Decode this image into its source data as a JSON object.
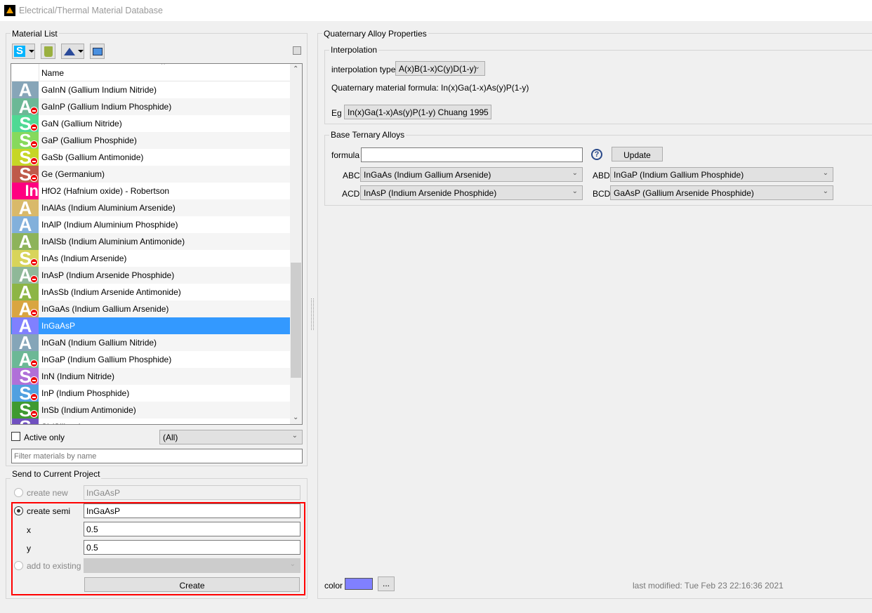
{
  "window": {
    "title": "Electrical/Thermal Material Database"
  },
  "material_list": {
    "title": "Material List",
    "column_name": "Name",
    "items": [
      {
        "name": "GaInN (Gallium Indium Nitride)",
        "letter": "A",
        "color": "#87a5b8",
        "badge": false
      },
      {
        "name": "GaInP (Gallium Indium Phosphide)",
        "letter": "A",
        "color": "#6cb896",
        "badge": true
      },
      {
        "name": "GaN (Gallium Nitride)",
        "letter": "S",
        "color": "#4fd994",
        "badge": true
      },
      {
        "name": "GaP (Gallium Phosphide)",
        "letter": "S",
        "color": "#86d95c",
        "badge": true
      },
      {
        "name": "GaSb (Gallium Antimonide)",
        "letter": "S",
        "color": "#c6d626",
        "badge": true
      },
      {
        "name": "Ge (Germanium)",
        "letter": "S",
        "color": "#bf5a4a",
        "badge": true
      },
      {
        "name": "HfO2 (Hafnium oxide) - Robertson",
        "letter": "In",
        "color": "#ff0080",
        "badge": false
      },
      {
        "name": "InAlAs (Indium Aluminium Arsenide)",
        "letter": "A",
        "color": "#d9b96a",
        "badge": false
      },
      {
        "name": "InAlP (Indium Aluminium Phosphide)",
        "letter": "A",
        "color": "#82b0db",
        "badge": false
      },
      {
        "name": "InAlSb (Indium Aluminium Antimonide)",
        "letter": "A",
        "color": "#8db35a",
        "badge": false
      },
      {
        "name": "InAs (Indium Arsenide)",
        "letter": "S",
        "color": "#d8d45a",
        "badge": true
      },
      {
        "name": "InAsP (Indium Arsenide Phosphide)",
        "letter": "A",
        "color": "#8fb898",
        "badge": true
      },
      {
        "name": "InAsSb (Indium Arsenide Antimonide)",
        "letter": "A",
        "color": "#8db545",
        "badge": false
      },
      {
        "name": "InGaAs (Indium Gallium Arsenide)",
        "letter": "A",
        "color": "#d9a540",
        "badge": true
      },
      {
        "name": "InGaAsP",
        "letter": "A",
        "color": "#8080ff",
        "badge": false,
        "selected": true
      },
      {
        "name": "InGaN (Indium Gallium Nitride)",
        "letter": "A",
        "color": "#85a5b8",
        "badge": false
      },
      {
        "name": "InGaP (Indium Gallium Phosphide)",
        "letter": "A",
        "color": "#6cb896",
        "badge": true
      },
      {
        "name": "InN (Indium Nitride)",
        "letter": "S",
        "color": "#b070d8",
        "badge": true
      },
      {
        "name": "InP (Indium Phosphide)",
        "letter": "S",
        "color": "#50a0e0",
        "badge": true
      },
      {
        "name": "InSb (Indium Antimonide)",
        "letter": "S",
        "color": "#3f9a30",
        "badge": true
      },
      {
        "name": "Si (Silicon)",
        "letter": "S",
        "color": "#7050c0",
        "badge": false
      }
    ],
    "active_only_label": "Active only",
    "category_value": "(All)",
    "filter_placeholder": "Filter materials by name"
  },
  "send": {
    "title": "Send to Current Project",
    "create_new_label": "create new",
    "create_new_value": "InGaAsP",
    "create_semi_label": "create semi",
    "create_semi_value": "InGaAsP",
    "x_label": "x",
    "x_value": "0.5",
    "y_label": "y",
    "y_value": "0.5",
    "add_existing_label": "add to existing",
    "create_button": "Create"
  },
  "props": {
    "title": "Quaternary Alloy Properties",
    "interp_title": "Interpolation",
    "interp_type_label": "interpolation type",
    "interp_type_value": "A(x)B(1-x)C(y)D(1-y)",
    "formula_text": "Quaternary material formula: In(x)Ga(1-x)As(y)P(1-y)",
    "eg_label": "Eg",
    "eg_value": "In(x)Ga(1-x)As(y)P(1-y) Chuang 1995",
    "ternary_title": "Base Ternary Alloys",
    "formula_label": "formula",
    "formula_value": "",
    "update_button": "Update",
    "abc_label": "ABC",
    "abc_value": "InGaAs (Indium Gallium Arsenide)",
    "abd_label": "ABD",
    "abd_value": "InGaP (Indium Gallium Phosphide)",
    "acd_label": "ACD",
    "acd_value": "InAsP (Indium Arsenide Phosphide)",
    "bcd_label": "BCD",
    "bcd_value": "GaAsP (Gallium Arsenide Phosphide)",
    "color_label": "color",
    "color_value": "#8080ff",
    "color_button": "...",
    "last_modified": "last modified: Tue Feb 23 22:16:36 2021"
  }
}
